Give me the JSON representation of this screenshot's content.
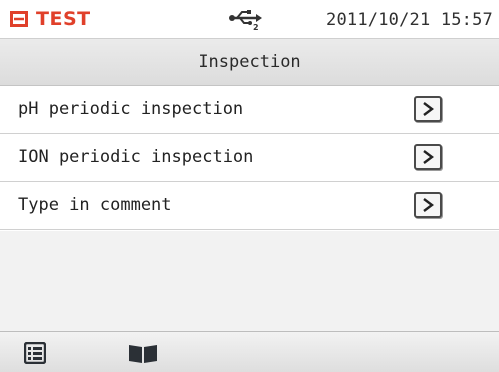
{
  "status": {
    "name": "TEST",
    "datetime": "2011/10/21 15:57",
    "icons": [
      "device-icon",
      "usb-icon"
    ],
    "accent_color": "#e0402a"
  },
  "header": {
    "title": "Inspection"
  },
  "menu": {
    "items": [
      {
        "label": "pH periodic inspection",
        "icon": "chevron-right-icon"
      },
      {
        "label": "ION periodic inspection",
        "icon": "chevron-right-icon"
      },
      {
        "label": "Type in comment",
        "icon": "chevron-right-icon"
      }
    ]
  },
  "bottom_bar": {
    "icons": [
      "list-icon",
      "book-icon"
    ]
  }
}
